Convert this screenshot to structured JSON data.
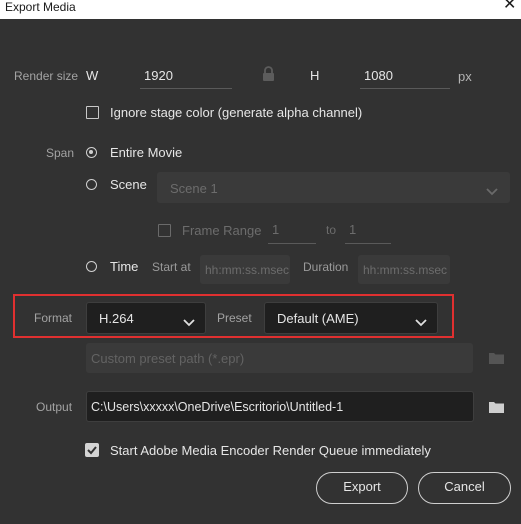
{
  "window": {
    "title": "Export Media"
  },
  "render_size": {
    "label": "Render size",
    "w_label": "W",
    "width": "1920",
    "h_label": "H",
    "height": "1080",
    "unit": "px"
  },
  "ignore_stage": {
    "label": "Ignore stage color (generate alpha channel)",
    "checked": false
  },
  "span": {
    "label": "Span",
    "entire_movie": "Entire Movie",
    "scene": "Scene",
    "scene_value": "Scene 1",
    "frame_range": {
      "label": "Frame Range",
      "from": "1",
      "to_label": "to",
      "to": "1"
    },
    "time": "Time",
    "start_at_label": "Start at",
    "start_placeholder": "hh:mm:ss.msec",
    "duration_label": "Duration",
    "duration_placeholder": "hh:mm:ss.msec",
    "selected": "Entire Movie"
  },
  "format": {
    "label": "Format",
    "value": "H.264",
    "preset_label": "Preset",
    "preset_value": "Default (AME)",
    "highlight_color": "#e03030"
  },
  "custom_preset": {
    "placeholder": "Custom preset path (*.epr)"
  },
  "output": {
    "label": "Output",
    "path": "C:\\Users\\xxxxx\\OneDrive\\Escritorio\\Untitled-1"
  },
  "start_ame": {
    "label": "Start Adobe Media Encoder Render Queue immediately",
    "checked": true
  },
  "buttons": {
    "export": "Export",
    "cancel": "Cancel"
  }
}
